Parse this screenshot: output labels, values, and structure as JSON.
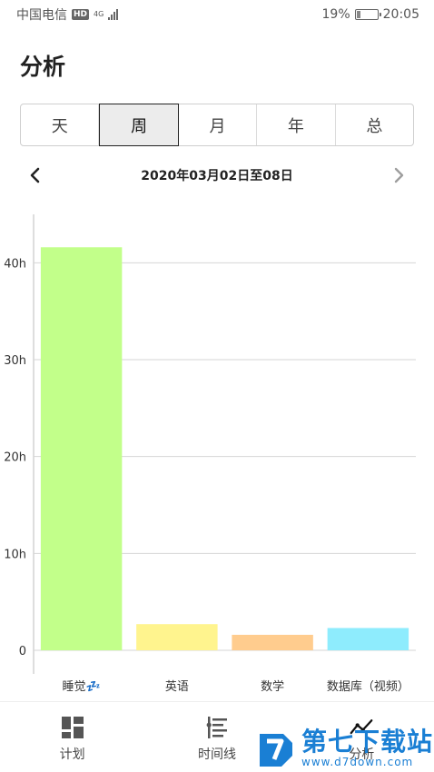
{
  "status_bar": {
    "carrier": "中国电信",
    "hd": "HD",
    "network": "4G",
    "battery_percent": "19%",
    "time": "20:05"
  },
  "page": {
    "title": "分析"
  },
  "period_tabs": [
    {
      "label": "天",
      "active": false
    },
    {
      "label": "周",
      "active": true
    },
    {
      "label": "月",
      "active": false
    },
    {
      "label": "年",
      "active": false
    },
    {
      "label": "总",
      "active": false
    }
  ],
  "date_nav": {
    "range": "2020年03月02日至08日",
    "prev_icon": "chevron-left-icon",
    "next_icon": "chevron-right-icon"
  },
  "chart_data": {
    "type": "bar",
    "categories": [
      "睡觉💤",
      "英语",
      "数学",
      "数据库（视频）"
    ],
    "values": [
      41.6,
      2.7,
      1.6,
      2.3
    ],
    "colors": [
      "#c2ff8a",
      "#fff48e",
      "#ffcc8e",
      "#8eecfd"
    ],
    "y_ticks": [
      {
        "value": 0,
        "label": "0"
      },
      {
        "value": 10,
        "label": "10h"
      },
      {
        "value": 20,
        "label": "20h"
      },
      {
        "value": 30,
        "label": "30h"
      },
      {
        "value": 40,
        "label": "40h"
      }
    ],
    "ylim": [
      0,
      45
    ],
    "grid": true
  },
  "bottom_nav": [
    {
      "label": "计划",
      "icon": "dashboard-grid-icon"
    },
    {
      "label": "时间线",
      "icon": "timeline-list-icon"
    },
    {
      "label": "分析",
      "icon": "trend-line-icon"
    }
  ],
  "watermark": {
    "title": "第七下载站",
    "url": "www.d7down.com"
  },
  "colors": {
    "accent": "#1a7fd4",
    "grid": "#d6d6d6",
    "axis": "#bdbdbd"
  }
}
